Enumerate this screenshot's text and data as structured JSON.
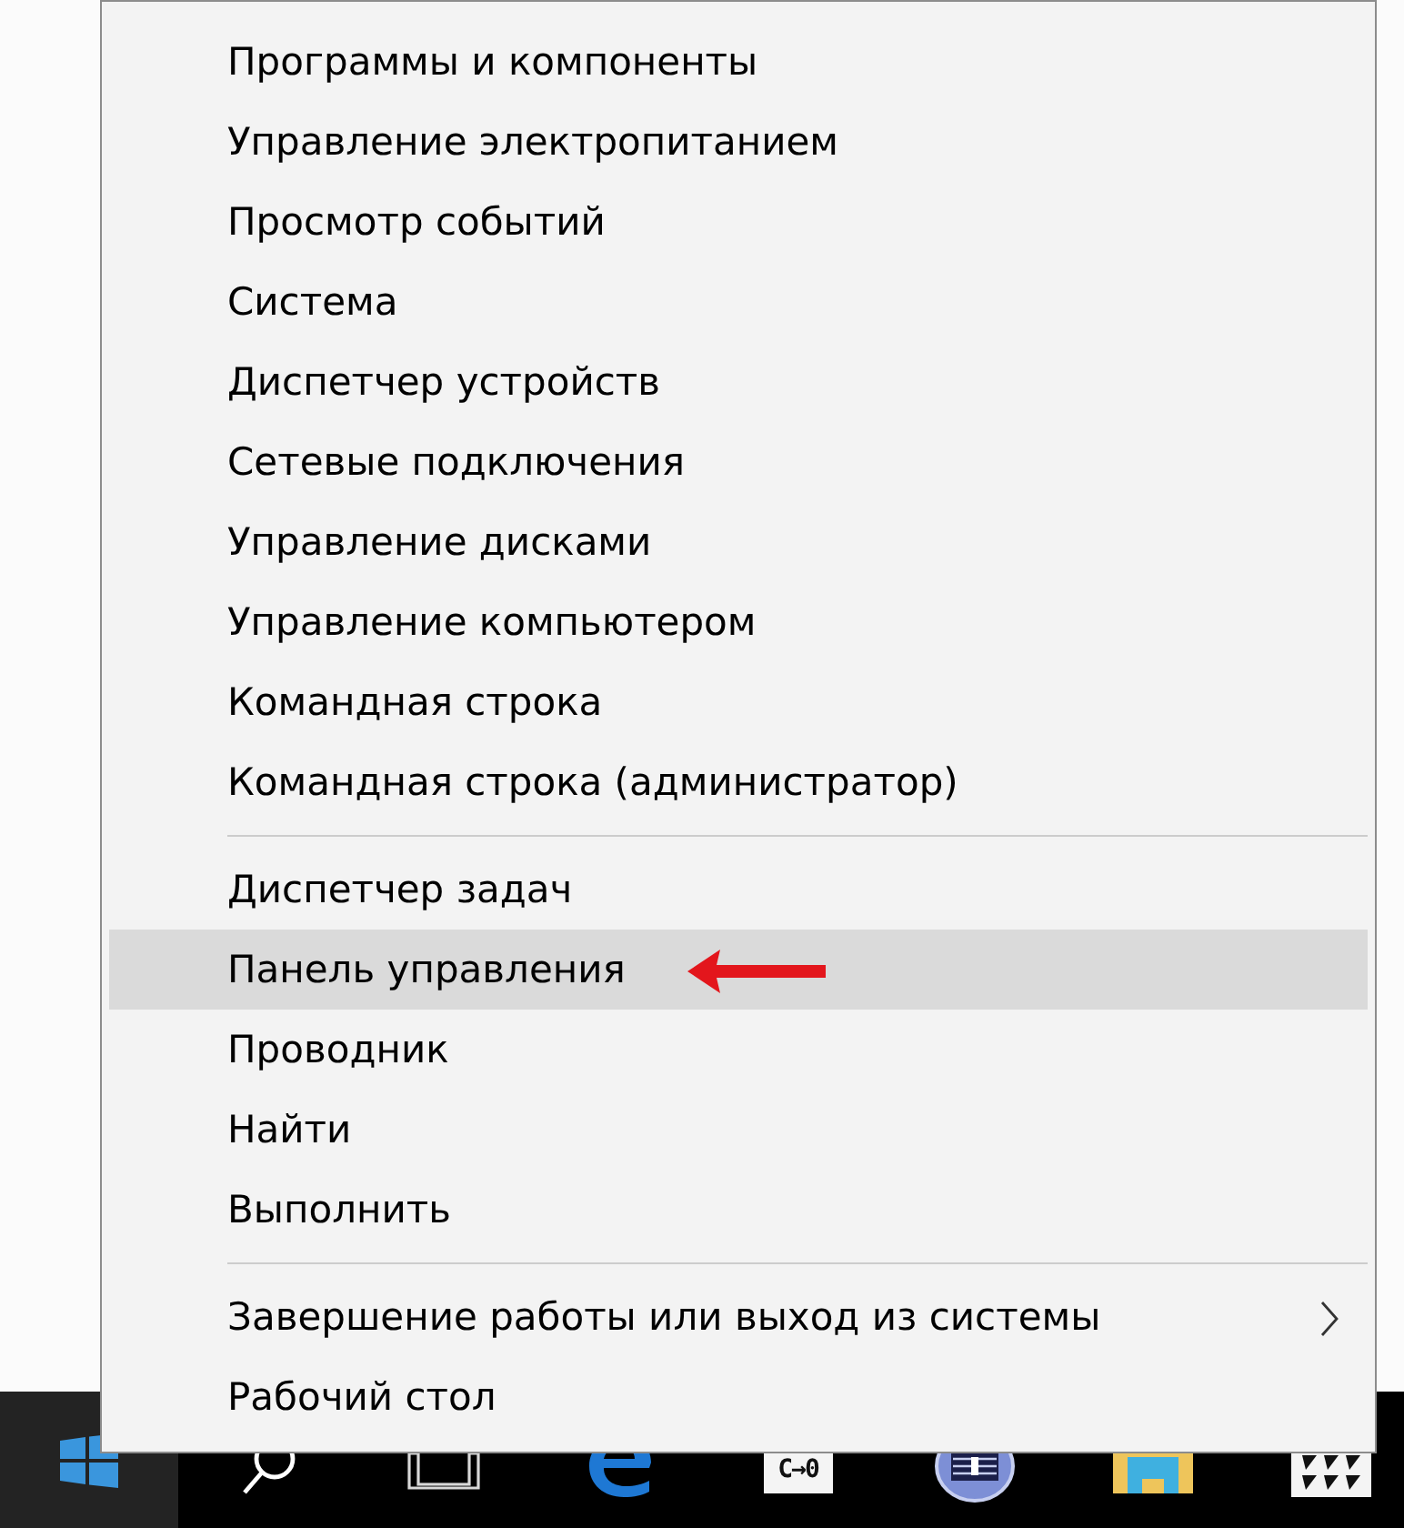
{
  "menu": {
    "groups": [
      {
        "items": [
          {
            "label": "Программы и компоненты",
            "selected": false,
            "submenu": false,
            "annotated": false
          },
          {
            "label": "Управление электропитанием",
            "selected": false,
            "submenu": false,
            "annotated": false
          },
          {
            "label": "Просмотр событий",
            "selected": false,
            "submenu": false,
            "annotated": false
          },
          {
            "label": "Система",
            "selected": false,
            "submenu": false,
            "annotated": false
          },
          {
            "label": "Диспетчер устройств",
            "selected": false,
            "submenu": false,
            "annotated": false
          },
          {
            "label": "Сетевые подключения",
            "selected": false,
            "submenu": false,
            "annotated": false
          },
          {
            "label": "Управление дисками",
            "selected": false,
            "submenu": false,
            "annotated": false
          },
          {
            "label": "Управление компьютером",
            "selected": false,
            "submenu": false,
            "annotated": false
          },
          {
            "label": "Командная строка",
            "selected": false,
            "submenu": false,
            "annotated": false
          },
          {
            "label": "Командная строка (администратор)",
            "selected": false,
            "submenu": false,
            "annotated": false
          }
        ]
      },
      {
        "items": [
          {
            "label": "Диспетчер задач",
            "selected": false,
            "submenu": false,
            "annotated": false
          },
          {
            "label": "Панель управления",
            "selected": true,
            "submenu": false,
            "annotated": true
          },
          {
            "label": "Проводник",
            "selected": false,
            "submenu": false,
            "annotated": false
          },
          {
            "label": "Найти",
            "selected": false,
            "submenu": false,
            "annotated": false
          },
          {
            "label": "Выполнить",
            "selected": false,
            "submenu": false,
            "annotated": false
          }
        ]
      },
      {
        "items": [
          {
            "label": "Завершение работы или выход из системы",
            "selected": false,
            "submenu": true,
            "annotated": false
          },
          {
            "label": "Рабочий стол",
            "selected": false,
            "submenu": false,
            "annotated": false
          }
        ]
      }
    ]
  },
  "taskbar": {
    "buttons": [
      {
        "kind": "start",
        "active": true
      },
      {
        "kind": "search",
        "active": false
      },
      {
        "kind": "task_view",
        "active": false
      },
      {
        "kind": "browser",
        "active": false
      },
      {
        "kind": "app_tile",
        "label": "C→0",
        "active": false
      },
      {
        "kind": "disc",
        "active": false
      },
      {
        "kind": "folder",
        "active": false
      },
      {
        "kind": "grid_tile",
        "active": false
      }
    ]
  }
}
